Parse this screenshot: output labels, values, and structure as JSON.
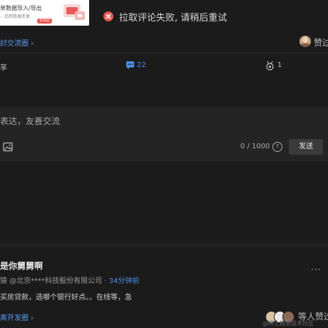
{
  "ad": {
    "line1": "单数据导入/导出",
    "line2": "、追踪数据变更",
    "tag": "去体验"
  },
  "toast": {
    "icon": "error-icon",
    "text": "拉取评论失败, 请稍后重试",
    "color": "#e35a4f"
  },
  "header": {
    "circle_link": "討交流圈 ›",
    "like_text": "赞过"
  },
  "actions": {
    "share_label": "享",
    "comment_icon": "comment-icon",
    "comment_count": "22",
    "medal_icon": "medal-icon",
    "medal_count": "1",
    "accent": "#4e8fe6"
  },
  "comment_box": {
    "placeholder": "表达，友善交流",
    "image_icon": "image-icon",
    "counter": "0 / 1000",
    "help_icon": "?",
    "send_label": "发送"
  },
  "post": {
    "title": "是你舅舅啊",
    "meta_author": "猿 @北京****科技股份有限公司 · ",
    "meta_time": "34分钟前",
    "more": "···",
    "body": "买房贷款，选哪个银行好点。。在线等，急",
    "circle_link": "离开发圈 ›",
    "likers": "等人赞过",
    "watermark": "@稀土掘金技术社区"
  }
}
